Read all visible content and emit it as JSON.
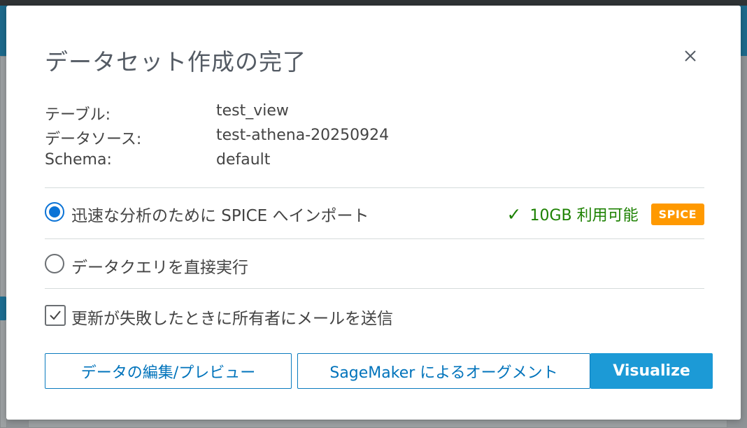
{
  "modal": {
    "title": "データセット作成の完了",
    "close_icon": "close-icon"
  },
  "details": {
    "table_label": "テーブル:",
    "table_value": "test_view",
    "datasource_label": "データソース:",
    "datasource_value": "test-athena-20250924",
    "schema_label": "Schema:",
    "schema_value": "default"
  },
  "options": {
    "spice_label": "迅速な分析のために SPICE へインポート",
    "spice_selected": true,
    "capacity_text": "10GB 利用可能",
    "capacity_icon": "check-icon",
    "badge": "SPICE",
    "direct_label": "データクエリを直接実行",
    "direct_selected": false,
    "notify_label": "更新が失敗したときに所有者にメールを送信",
    "notify_checked": true
  },
  "buttons": {
    "edit_preview": "データの編集/プレビュー",
    "sagemaker": "SageMaker によるオーグメント",
    "visualize": "Visualize"
  },
  "colors": {
    "primary": "#1c9ad6",
    "link": "#0073bb",
    "success": "#1d8102",
    "badge": "#ff9900",
    "radio_selected": "#0b73d6"
  }
}
